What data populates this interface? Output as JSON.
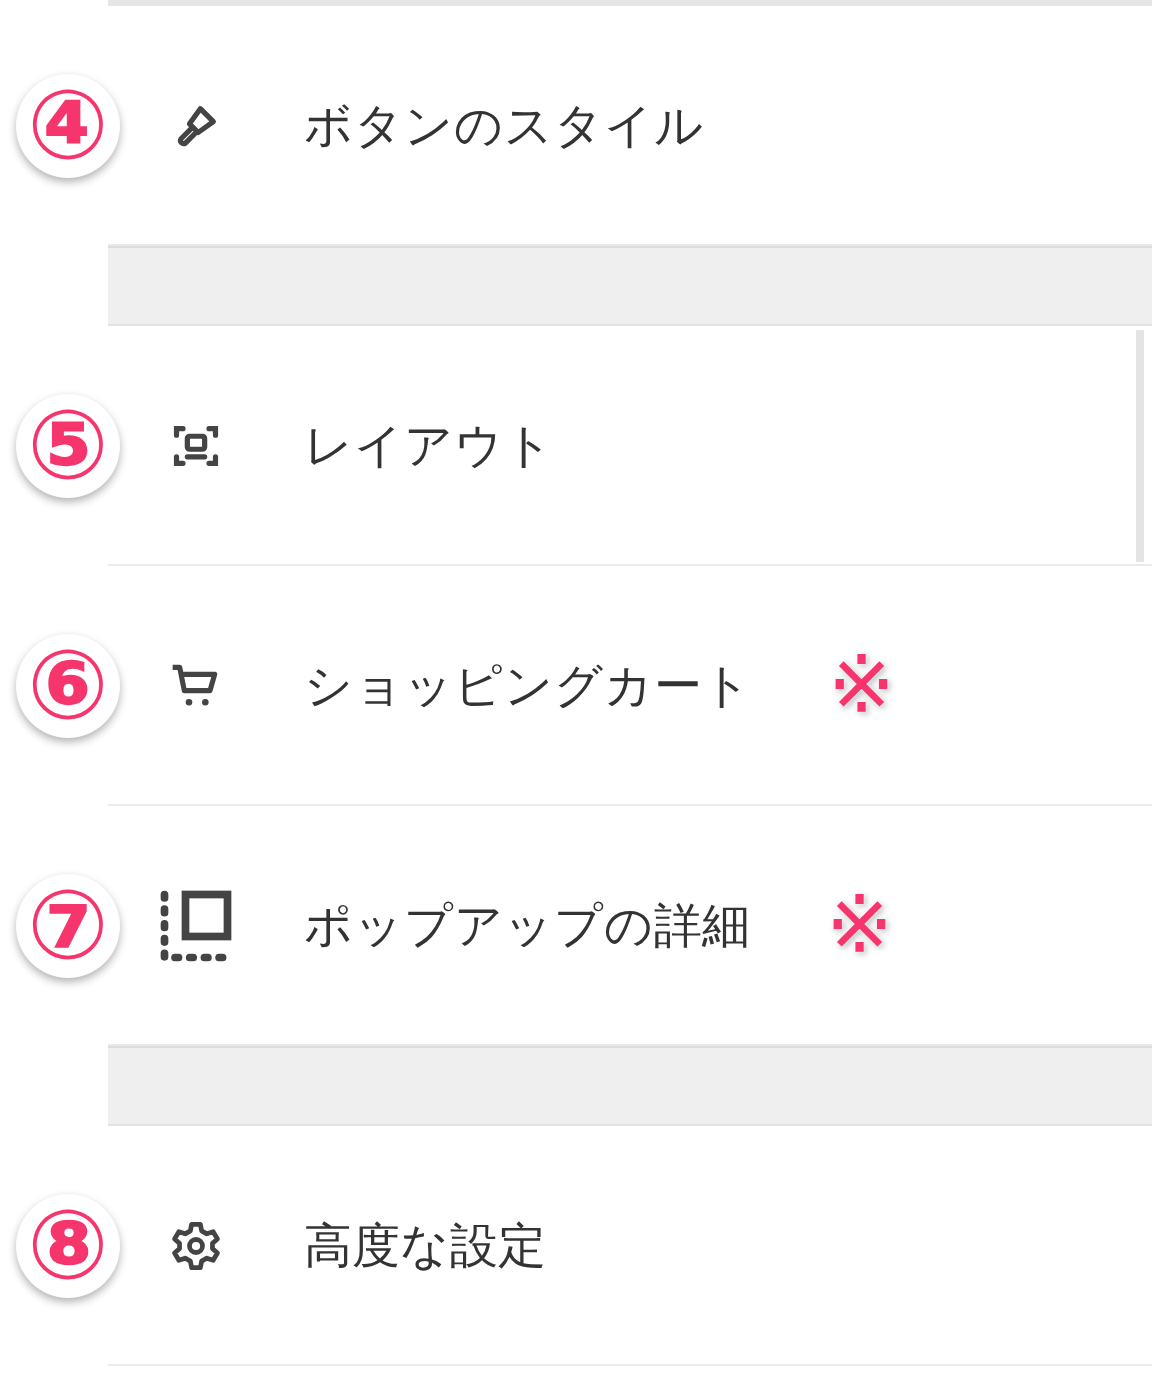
{
  "groups": [
    {
      "items": [
        {
          "badge": "④",
          "label": "ボタンのスタイル"
        }
      ]
    },
    {
      "items": [
        {
          "badge": "⑤",
          "label": "レイアウト"
        },
        {
          "badge": "⑥",
          "label": "ショッピングカート",
          "note": "※"
        },
        {
          "badge": "⑦",
          "label": "ポップアップの詳細",
          "note": "※"
        }
      ]
    },
    {
      "items": [
        {
          "badge": "⑧",
          "label": "高度な設定"
        }
      ]
    }
  ]
}
